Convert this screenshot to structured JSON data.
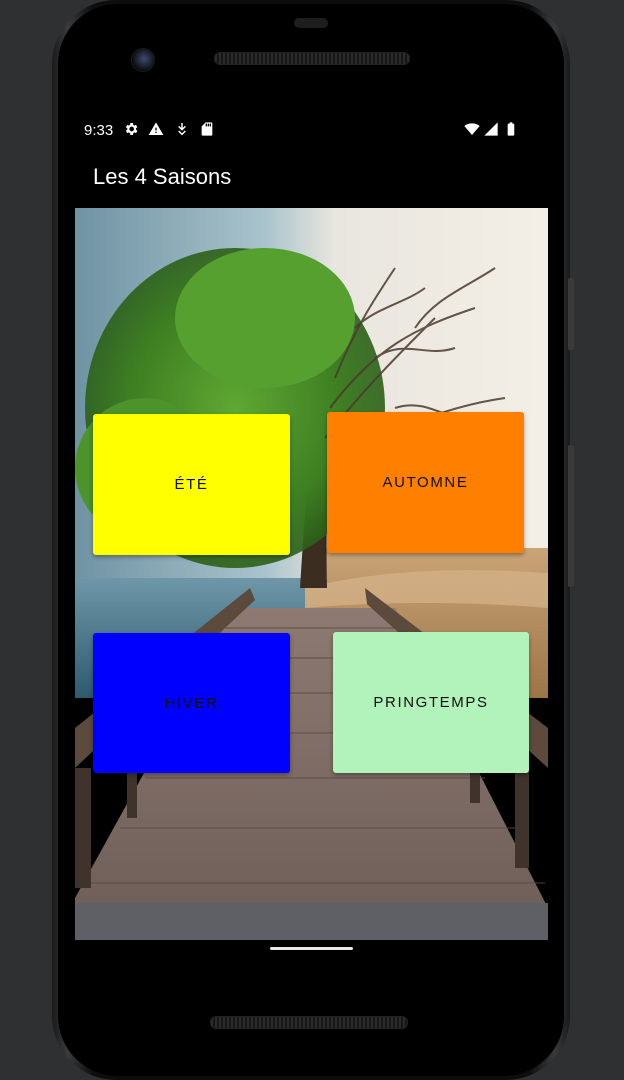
{
  "status_bar": {
    "time": "9:33",
    "left_icons": [
      "settings-icon",
      "warning-icon",
      "download-icon",
      "sd-card-icon"
    ],
    "right_icons": [
      "wifi-icon",
      "signal-icon",
      "battery-icon"
    ]
  },
  "app_bar": {
    "title": "Les 4 Saisons"
  },
  "buttons": {
    "ete": {
      "label": "ÉTÉ",
      "color": "#FFFF00"
    },
    "automne": {
      "label": "AUTOMNE",
      "color": "#FF7F00"
    },
    "hiver": {
      "label": "HIVER",
      "color": "#0000FF"
    },
    "printemps": {
      "label": "PRINGTEMPS",
      "color": "#B2F2BB"
    }
  },
  "background": {
    "description_icon": "seasons-tree-pier-image"
  }
}
